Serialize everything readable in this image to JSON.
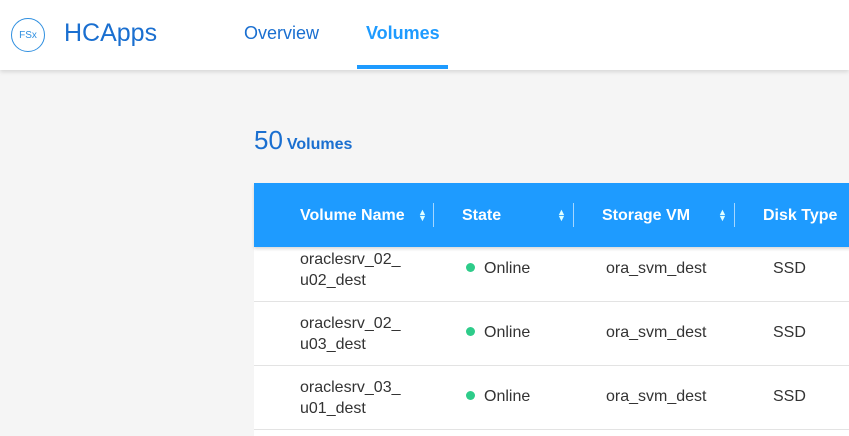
{
  "header": {
    "logo_text": "FSx",
    "app_name": "HCApps",
    "tabs": [
      {
        "label": "Overview"
      },
      {
        "label": "Volumes",
        "active": true
      }
    ]
  },
  "summary": {
    "count": "50",
    "label": "Volumes"
  },
  "table": {
    "columns": [
      "Volume Name",
      "State",
      "Storage VM",
      "Disk Type"
    ],
    "rows": [
      {
        "name_l1": "oraclesrv_02_",
        "name_l2": "u02_dest",
        "state": "Online",
        "svm": "ora_svm_dest",
        "disk": "SSD"
      },
      {
        "name_l1": "oraclesrv_02_",
        "name_l2": "u03_dest",
        "state": "Online",
        "svm": "ora_svm_dest",
        "disk": "SSD"
      },
      {
        "name_l1": "oraclesrv_03_",
        "name_l2": "u01_dest",
        "state": "Online",
        "svm": "ora_svm_dest",
        "disk": "SSD"
      }
    ]
  },
  "colors": {
    "accent": "#1e9bff",
    "online": "#2ecc8a",
    "brand": "#1a6fd0"
  }
}
